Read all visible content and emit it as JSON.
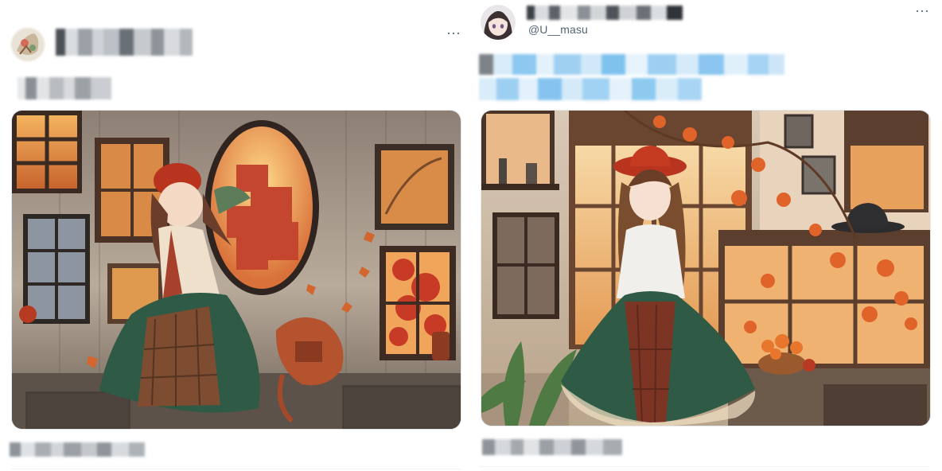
{
  "right_post": {
    "handle": "@U__masu",
    "more_label": "···"
  },
  "left_post": {
    "more_label": "···"
  },
  "colors": {
    "handle_gray": "#536471",
    "link_blue": "#1d9bf0",
    "divider": "#eff3f4"
  },
  "icons": {
    "more": "more-horizontal-icon",
    "left_avatar": "avatar",
    "right_avatar": "avatar"
  }
}
